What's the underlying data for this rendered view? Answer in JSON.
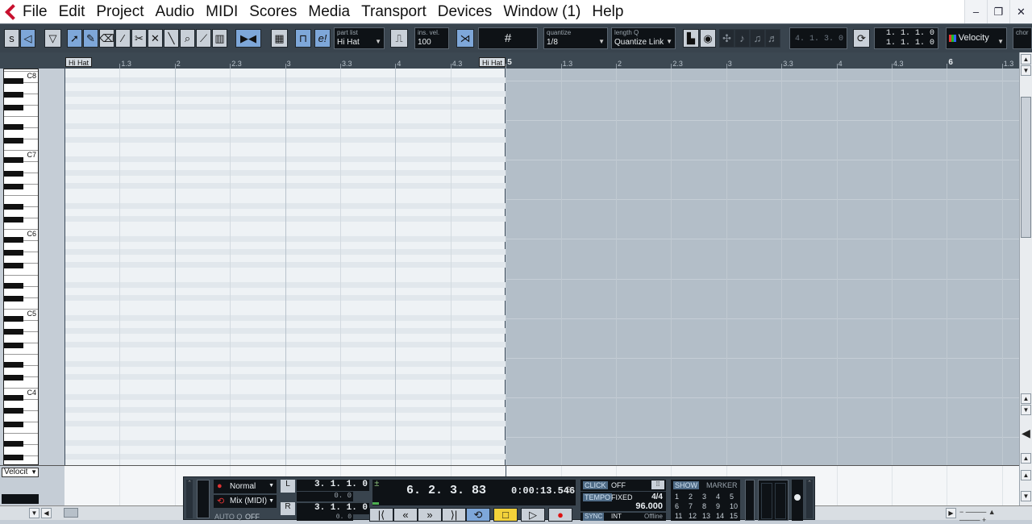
{
  "menubar": {
    "items": [
      "File",
      "Edit",
      "Project",
      "Audio",
      "MIDI",
      "Scores",
      "Media",
      "Transport",
      "Devices",
      "Window (1)",
      "Help"
    ]
  },
  "window_controls": {
    "minimize": "–",
    "restore": "❐",
    "close": "✕"
  },
  "toolbar": {
    "part_list_label": "part list",
    "part_list_value": "Hi Hat",
    "ins_vel_label": "ins. vel.",
    "ins_vel_value": "100",
    "quantize_label": "quantize",
    "quantize_value": "1/8",
    "length_label": "length Q",
    "length_value": "Quantize Link",
    "grid_symbol": "#",
    "left_counter": "4. 1. 3.   0",
    "right_counter_top": "1. 1. 1.   0",
    "right_counter_bottom": "1. 1. 1.   0",
    "controller_label": "Velocity",
    "chord_label": "chor"
  },
  "ruler": {
    "labels": [
      "1.3",
      "2",
      "2.3",
      "3",
      "3.3",
      "4",
      "4.3",
      "5",
      "1.3",
      "2",
      "2.3",
      "3",
      "3.3",
      "4",
      "4.3",
      "6",
      "1.3"
    ],
    "part_start_tag": "Hi Hat",
    "part_end_tag": "Hi Hat"
  },
  "keyboard": {
    "octave_labels": [
      "C8",
      "C7",
      "C6",
      "C5",
      "C4"
    ]
  },
  "controller_lane": {
    "selector_value": "Velocit"
  },
  "transport": {
    "mode_label": "Normal",
    "mix_label": "Mix (MIDI)",
    "auto_q_label": "AUTO Q",
    "auto_q_value": "OFF",
    "left_locator_label": "L",
    "left_locator": "3. 1. 1.   0",
    "left_sub": "0.   0",
    "right_locator_label": "R",
    "right_locator": "3. 1. 1.   0",
    "right_sub": "0.   0",
    "position_bars": "6. 2. 3. 83",
    "position_time": "0:00:13.546",
    "click_label": "CLICK",
    "click_value": "OFF",
    "tempo_label": "TEMPO",
    "tempo_mode": "FIXED",
    "signature": "4/4",
    "tempo_value": "96.000",
    "sync_label": "SYNC",
    "sync_value": "INT",
    "sync_state": "Offline",
    "show_label": "SHOW",
    "marker_label": "MARKER",
    "marker_numbers_row1": [
      "1",
      "2",
      "3",
      "4",
      "5"
    ],
    "marker_numbers_row2": [
      "6",
      "7",
      "8",
      "9",
      "10"
    ],
    "marker_numbers_row3": [
      "11",
      "12",
      "13",
      "14",
      "15"
    ]
  }
}
